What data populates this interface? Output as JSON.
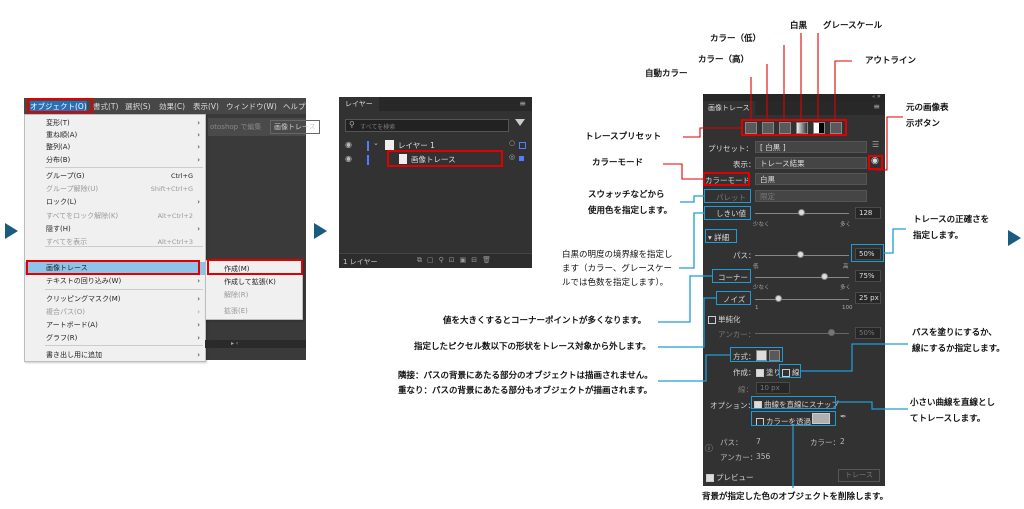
{
  "menubar": {
    "items": [
      "オブジェクト(O)",
      "書式(T)",
      "選択(S)",
      "効果(C)",
      "表示(V)",
      "ウィンドウ(W)",
      "ヘルプ"
    ],
    "bg_text_left": "otoshop で編集",
    "bg_text_right": "画像トレース"
  },
  "object_menu": {
    "items": [
      {
        "label": "変形(T)",
        "shortcut": "",
        "arrow": true,
        "disabled": false
      },
      {
        "label": "重ね順(A)",
        "shortcut": "",
        "arrow": true,
        "disabled": false
      },
      {
        "label": "整列(A)",
        "shortcut": "",
        "arrow": true,
        "disabled": false
      },
      {
        "label": "分布(B)",
        "shortcut": "",
        "arrow": true,
        "disabled": false
      },
      {
        "label": "グループ(G)",
        "shortcut": "Ctrl+G",
        "arrow": false,
        "disabled": false
      },
      {
        "label": "グループ解除(U)",
        "shortcut": "Shift+Ctrl+G",
        "arrow": false,
        "disabled": true
      },
      {
        "label": "ロック(L)",
        "shortcut": "",
        "arrow": true,
        "disabled": false
      },
      {
        "label": "すべてをロック解除(K)",
        "shortcut": "Alt+Ctrl+2",
        "arrow": false,
        "disabled": true
      },
      {
        "label": "隠す(H)",
        "shortcut": "",
        "arrow": true,
        "disabled": false
      },
      {
        "label": "すべてを表示",
        "shortcut": "Alt+Ctrl+3",
        "arrow": false,
        "disabled": true
      },
      {
        "label": "画像トレース",
        "shortcut": "",
        "arrow": true,
        "disabled": false
      },
      {
        "label": "テキストの回り込み(W)",
        "shortcut": "",
        "arrow": true,
        "disabled": false
      },
      {
        "label": "クリッピングマスク(M)",
        "shortcut": "",
        "arrow": true,
        "disabled": false
      },
      {
        "label": "複合パス(O)",
        "shortcut": "",
        "arrow": true,
        "disabled": true
      },
      {
        "label": "アートボード(A)",
        "shortcut": "",
        "arrow": true,
        "disabled": false
      },
      {
        "label": "グラフ(R)",
        "shortcut": "",
        "arrow": true,
        "disabled": false
      },
      {
        "label": "書き出し用に追加",
        "shortcut": "",
        "arrow": true,
        "disabled": false
      }
    ],
    "submenu": [
      {
        "label": "作成(M)",
        "disabled": false
      },
      {
        "label": "作成して拡張(K)",
        "disabled": false
      },
      {
        "label": "解除(R)",
        "disabled": true
      },
      {
        "label": "拡張(E)",
        "disabled": true
      }
    ]
  },
  "layers_panel": {
    "title": "レイヤー",
    "search_placeholder": "すべてを検索",
    "layer_name": "レイヤー 1",
    "sublayer_name": "画像トレース",
    "footer": "1 レイヤー"
  },
  "trace_panel": {
    "title": "画像トレース",
    "preset_label": "プリセット：",
    "preset_value": "[ 白黒 ]",
    "view_label": "表示：",
    "view_value": "トレース結果",
    "mode_label": "カラーモード",
    "mode_value": "白黒",
    "palette_label": "パレット",
    "palette_value": "限定",
    "threshold_label": "しきい値",
    "threshold_value": "128",
    "threshold_min": "少なく",
    "threshold_max": "多く",
    "details_label": "詳細",
    "path_label": "パス：",
    "path_value": "50%",
    "path_min": "低",
    "path_max": "高",
    "corner_label": "コーナー",
    "corner_value": "75%",
    "corner_min": "少なく",
    "corner_max": "多く",
    "noise_label": "ノイズ",
    "noise_value": "25 px",
    "noise_min": "1",
    "noise_max": "100",
    "simplify_label": "単純化",
    "anchor_label": "アンカー：",
    "anchor_value": "50%",
    "method_label": "方式：",
    "create_label": "作成：",
    "fill_label": "塗り",
    "stroke_label": "線",
    "stroke_row_label": "線：",
    "stroke_value": "10 px",
    "options_label": "オプション：",
    "snap_label": "曲線を直線にスナップ",
    "ignore_color_label": "カラーを透過",
    "stat_paths_label": "パス：",
    "stat_paths_value": "7",
    "stat_colors_label": "カラー：",
    "stat_colors_value": "2",
    "stat_anchors_label": "アンカー：",
    "stat_anchors_value": "356",
    "preview_label": "プレビュー",
    "trace_button": "トレース"
  },
  "annotations": {
    "white_black": "白黒",
    "grayscale": "グレースケール",
    "color_low": "カラー（低）",
    "color_high": "カラー（高）",
    "auto_color": "自動カラー",
    "outline": "アウトライン",
    "original_image_1": "元の画像表",
    "original_image_2": "示ボタン",
    "trace_preset": "トレースプリセット",
    "color_mode": "カラーモード",
    "swatch_1": "スウォッチなどから",
    "swatch_2": "使用色を指定します。",
    "accuracy_1": "トレースの正確さを",
    "accuracy_2": "指定します。",
    "threshold_1": "白黒の明度の境界線を指定し",
    "threshold_2": "ます（カラー、グレースケー",
    "threshold_3": "ルでは色数を指定します）。",
    "corner": "値を大きくするとコーナーポイントが多くなります。",
    "noise": "指定したピクセル数以下の形状をトレース対象から外します。",
    "method_1": "隣接：パスの背景にあたる部分のオブジェクトは描画されません。",
    "method_2": "重なり：パスの背景にあたる部分もオブジェクトが描画されます。",
    "fill_stroke_1": "パスを塗りにするか、",
    "fill_stroke_2": "線にするか指定します。",
    "snap_1": "小さい曲線を直線とし",
    "snap_2": "てトレースします。",
    "ignore": "背景が指定した色のオブジェクトを削除します。"
  },
  "colors": {
    "accent_red": "#e10000",
    "accent_blue": "#1e9cd7",
    "arrow": "#1a5c7e",
    "panel_dark": "#323232",
    "menu_highlight": "#8fc3ea"
  }
}
